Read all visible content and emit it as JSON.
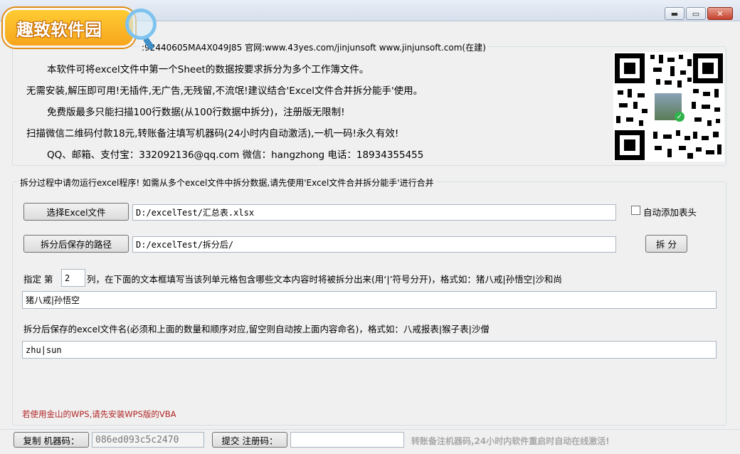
{
  "window": {
    "minimize": "▬",
    "maximize": "▭",
    "close": "✕"
  },
  "logo": {
    "text": "趣致软件园"
  },
  "info": {
    "legend": ":92440605MA4X049J85 官网:www.43yes.com/jinjunsoft  www.jinjunsoft.com(在建)",
    "line1": "本软件可将excel文件中第一个Sheet的数据按要求拆分为多个工作簿文件。",
    "line2": "无需安装,解压即可用!无插件,无广告,无残留,不流氓!建议结合'Excel文件合并拆分能手'使用。",
    "line3": "免费版最多只能扫描100行数据(从100行数据中拆分)，注册版无限制!",
    "line4": "扫描微信二维码付款18元,转账备注填写机器码(24小时内自动激活),一机一码!永久有效!",
    "line5": "QQ、邮箱、支付宝：332092136@qq.com    微信：hangzhong    电话：18934355455"
  },
  "split": {
    "legend": "拆分过程中请勿运行excel程序! 如需从多个excel文件中拆分数据,请先使用'Excel文件合并拆分能手'进行合并",
    "select_button": "选择Excel文件",
    "file_path": "D:/excelTest/汇总表.xlsx",
    "auto_header_label": "自动添加表头",
    "auto_header_checked": false,
    "save_button": "拆分后保存的路径",
    "save_path": "D:/excelTest/拆分后/",
    "split_button": "拆 分",
    "col_prefix": "指定 第",
    "col_value": "2",
    "col_suffix": "列，在下面的文本框填写当该列单元格包含哪些文本内容时将被拆分出来(用‘|’符号分开)，格式如：猪八戒|孙悟空|沙和尚",
    "keywords": "猪八戒|孙悟空",
    "names_label": "拆分后保存的excel文件名(必须和上面的数量和顺序对应,留空则自动按上面内容命名)，格式如：八戒报表|猴子表|沙僧",
    "names_value": "zhu|sun",
    "wps_warning": "若使用金山的WPS,请先安装WPS版的VBA"
  },
  "status": {
    "copy_button": "复制 机器码：",
    "machine_code": "086ed093c5c2470",
    "submit_button": "提交 注册码：",
    "reg_code": "",
    "note": "转账备注机器码,24小时内软件重启时自动在线激活!"
  },
  "colors": {
    "warning_text": "#b22222",
    "note_text": "#a9a9a9"
  }
}
